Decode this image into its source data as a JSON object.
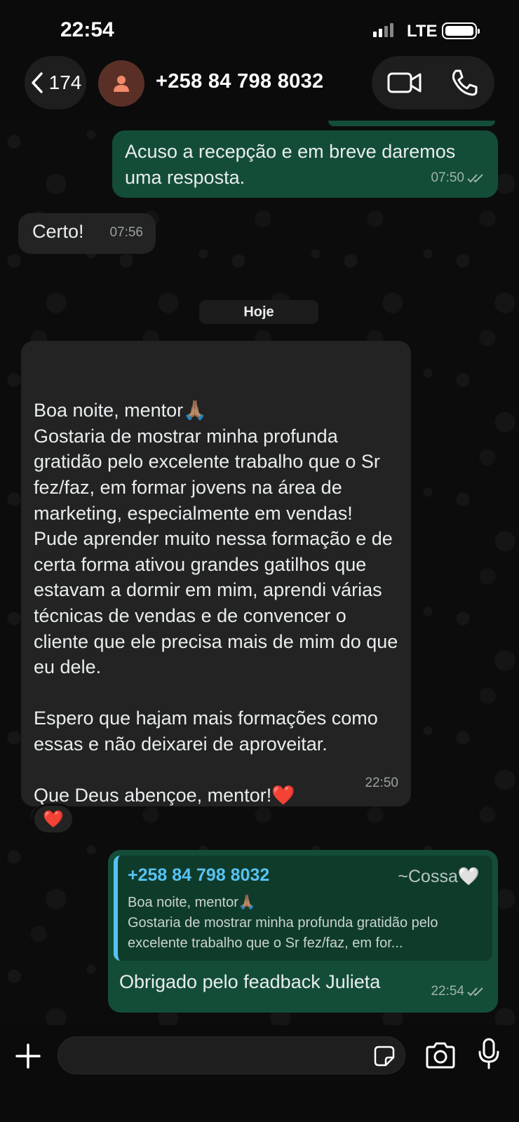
{
  "status_bar": {
    "time": "22:54",
    "network": "LTE",
    "battery_level": 1.0
  },
  "header": {
    "back_count": "174",
    "contact_name": "+258 84 798 8032",
    "icons": {
      "back": "chevron-left-icon",
      "avatar": "person-icon",
      "video": "video-camera-icon",
      "call": "phone-icon"
    }
  },
  "messages": {
    "m1": {
      "text": "Acuso a recepção e em breve daremos uma resposta.",
      "time": "07:50",
      "direction": "outgoing",
      "status": "read"
    },
    "m2": {
      "text": "Certo!",
      "time": "07:56",
      "direction": "incoming"
    },
    "day_separator": "Hoje",
    "m3": {
      "text": "Boa noite, mentor🙏🏽\nGostaria de mostrar minha profunda gratidão pelo excelente trabalho que o Sr fez/faz, em formar jovens na área de marketing, especialmente em vendas!\nPude aprender muito nessa formação e de certa forma ativou grandes gatilhos que estavam a dormir em mim, aprendi várias técnicas de vendas e de convencer o cliente que ele precisa mais de mim do que eu dele.\n\nEspero que hajam mais formações como essas e não deixarei de aproveitar.\n\nQue Deus abençoe, mentor!❤️",
      "time": "22:50",
      "direction": "incoming",
      "reaction": "❤️"
    },
    "m4": {
      "quote_author": "+258 84 798 8032",
      "quote_alias": "~Cossa🤍",
      "quote_text": "Boa noite, mentor🙏🏽\nGostaria de mostrar minha profunda gratidão pelo excelente trabalho que o Sr fez/faz, em for...",
      "text": "Obrigado pelo feadback Julieta",
      "time": "22:54",
      "direction": "outgoing",
      "status": "read"
    }
  },
  "input_bar": {
    "placeholder": "",
    "icons": {
      "attach": "plus-icon",
      "sticker": "sticker-icon",
      "camera": "camera-icon",
      "mic": "microphone-icon"
    }
  },
  "colors": {
    "outgoing_bubble": "#134d37",
    "incoming_bubble": "#222322",
    "quote_accent": "#57c3f2",
    "avatar_bg": "#5a3026",
    "avatar_fg": "#f08a6a"
  }
}
